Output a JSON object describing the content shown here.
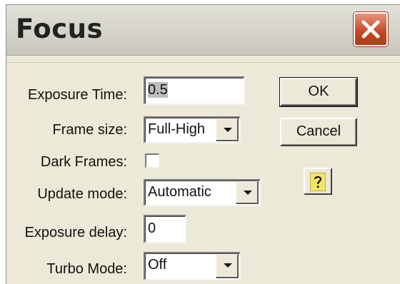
{
  "window": {
    "title": "Focus"
  },
  "fields": {
    "exposure_time": {
      "label": "Exposure Time:",
      "value": "0.5"
    },
    "frame_size": {
      "label": "Frame size:",
      "value": "Full-High"
    },
    "dark_frames": {
      "label": "Dark Frames:",
      "checked": false
    },
    "update_mode": {
      "label": "Update mode:",
      "value": "Automatic"
    },
    "exposure_delay": {
      "label": "Exposure delay:",
      "value": "0"
    },
    "turbo_mode": {
      "label": "Turbo Mode:",
      "value": "Off"
    }
  },
  "buttons": {
    "ok": "OK",
    "cancel": "Cancel"
  },
  "icons": {
    "close": "close-icon",
    "help": "help-icon",
    "dropdown": "chevron-down-icon"
  },
  "colors": {
    "close_button": "#c4471f",
    "dialog_bg": "#ece9d8"
  }
}
